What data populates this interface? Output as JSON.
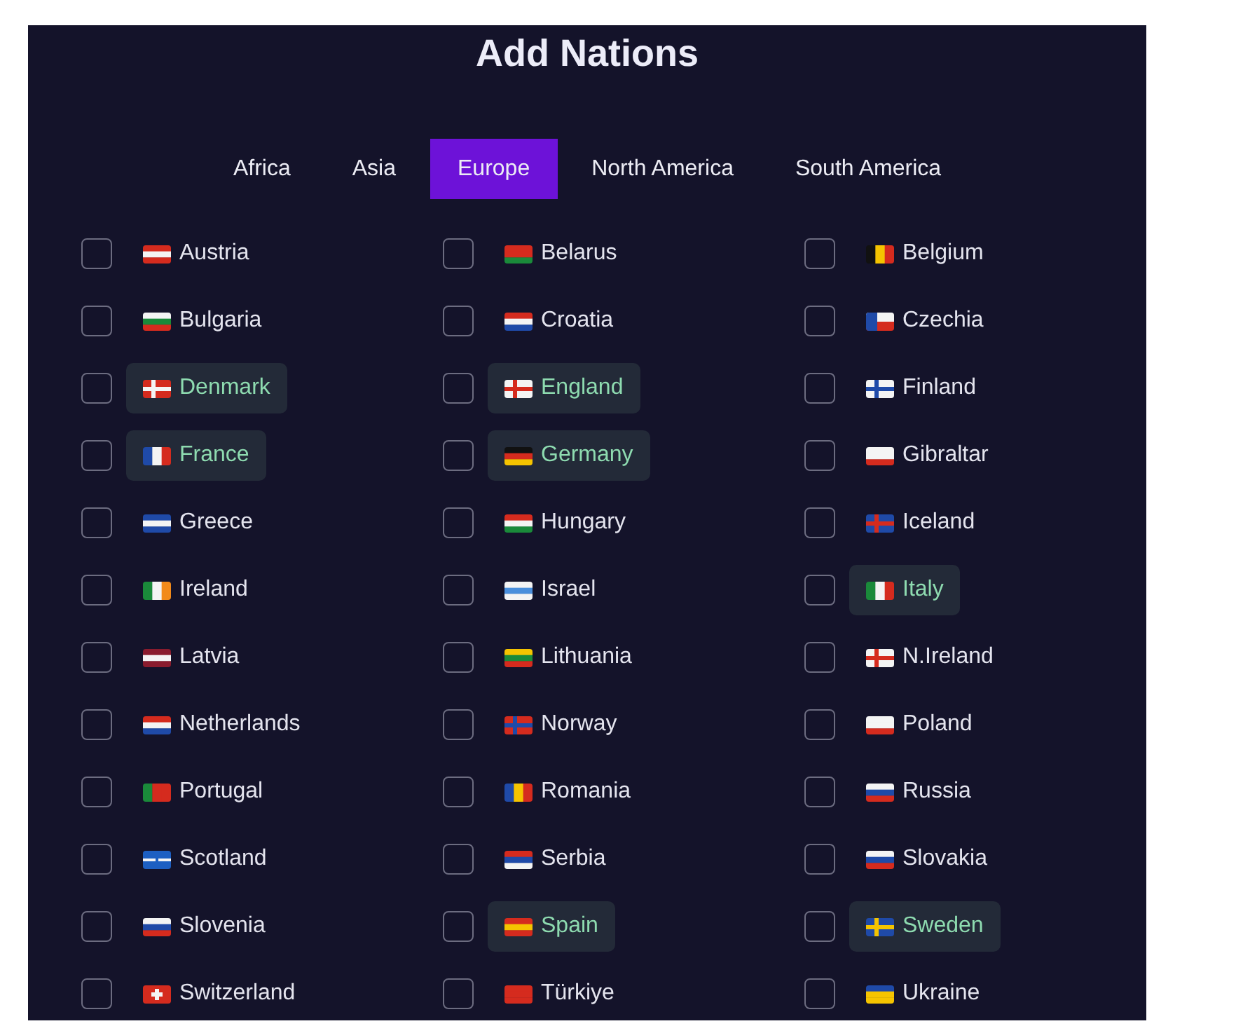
{
  "title": "Add Nations",
  "tabs": [
    {
      "label": "Africa",
      "selected": false
    },
    {
      "label": "Asia",
      "selected": false
    },
    {
      "label": "Europe",
      "selected": true
    },
    {
      "label": "North America",
      "selected": false
    },
    {
      "label": "South America",
      "selected": false
    }
  ],
  "nations": [
    {
      "name": "Austria",
      "checked": false,
      "highlighted": false
    },
    {
      "name": "Belarus",
      "checked": false,
      "highlighted": false
    },
    {
      "name": "Belgium",
      "checked": false,
      "highlighted": false
    },
    {
      "name": "Bulgaria",
      "checked": false,
      "highlighted": false
    },
    {
      "name": "Croatia",
      "checked": false,
      "highlighted": false
    },
    {
      "name": "Czechia",
      "checked": false,
      "highlighted": false
    },
    {
      "name": "Denmark",
      "checked": false,
      "highlighted": true
    },
    {
      "name": "England",
      "checked": false,
      "highlighted": true
    },
    {
      "name": "Finland",
      "checked": false,
      "highlighted": false
    },
    {
      "name": "France",
      "checked": false,
      "highlighted": true
    },
    {
      "name": "Germany",
      "checked": false,
      "highlighted": true
    },
    {
      "name": "Gibraltar",
      "checked": false,
      "highlighted": false
    },
    {
      "name": "Greece",
      "checked": false,
      "highlighted": false
    },
    {
      "name": "Hungary",
      "checked": false,
      "highlighted": false
    },
    {
      "name": "Iceland",
      "checked": false,
      "highlighted": false
    },
    {
      "name": "Ireland",
      "checked": false,
      "highlighted": false
    },
    {
      "name": "Israel",
      "checked": false,
      "highlighted": false
    },
    {
      "name": "Italy",
      "checked": false,
      "highlighted": true
    },
    {
      "name": "Latvia",
      "checked": false,
      "highlighted": false
    },
    {
      "name": "Lithuania",
      "checked": false,
      "highlighted": false
    },
    {
      "name": "N.Ireland",
      "checked": false,
      "highlighted": false
    },
    {
      "name": "Netherlands",
      "checked": false,
      "highlighted": false
    },
    {
      "name": "Norway",
      "checked": false,
      "highlighted": false
    },
    {
      "name": "Poland",
      "checked": false,
      "highlighted": false
    },
    {
      "name": "Portugal",
      "checked": false,
      "highlighted": false
    },
    {
      "name": "Romania",
      "checked": false,
      "highlighted": false
    },
    {
      "name": "Russia",
      "checked": false,
      "highlighted": false
    },
    {
      "name": "Scotland",
      "checked": false,
      "highlighted": false
    },
    {
      "name": "Serbia",
      "checked": false,
      "highlighted": false
    },
    {
      "name": "Slovakia",
      "checked": false,
      "highlighted": false
    },
    {
      "name": "Slovenia",
      "checked": false,
      "highlighted": false
    },
    {
      "name": "Spain",
      "checked": false,
      "highlighted": true
    },
    {
      "name": "Sweden",
      "checked": false,
      "highlighted": true
    },
    {
      "name": "Switzerland",
      "checked": false,
      "highlighted": false
    },
    {
      "name": "Türkiye",
      "checked": false,
      "highlighted": false
    },
    {
      "name": "Ukraine",
      "checked": false,
      "highlighted": false
    }
  ]
}
